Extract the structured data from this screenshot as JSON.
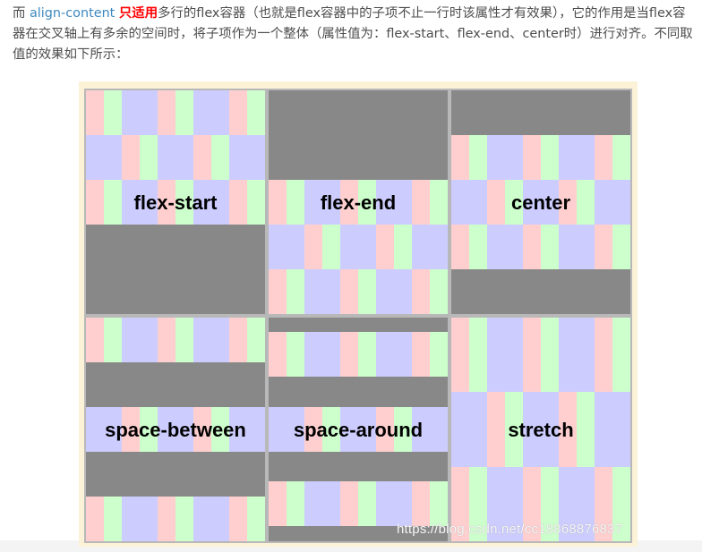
{
  "intro": {
    "prefix": "而 ",
    "keyword": "align-content",
    "space": " ",
    "emphasis": "只适用",
    "text": "多行的flex容器（也就是flex容器中的子项不止一行时该属性才有效果），它的作用是当flex容器在交叉轴上有多余的空间时，将子项作为一个整体（属性值为：flex-start、flex-end、center时）进行对齐。不同取值的效果如下所示："
  },
  "figure": {
    "labels": [
      "flex-start",
      "flex-end",
      "center",
      "space-between",
      "space-around",
      "stretch"
    ]
  },
  "watermark": "https://blog.csdn.net/cc18868876837"
}
